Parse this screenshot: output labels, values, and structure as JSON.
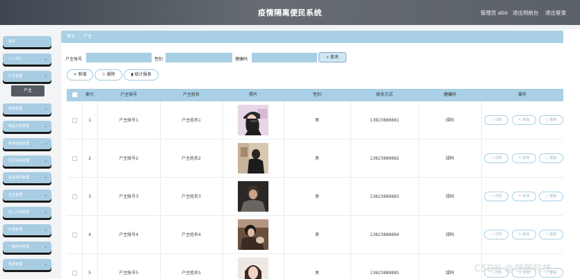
{
  "header": {
    "title": "疫情隔离便民系统",
    "admin": "管理员 abo",
    "back_to_front": "退出到前台",
    "logout": "退出登录"
  },
  "sidebar": {
    "items": [
      {
        "label": "首页"
      },
      {
        "label": "个人中心"
      },
      {
        "label": "户主管理"
      },
      {
        "label": "物资管理"
      },
      {
        "label": "物品分类管理"
      },
      {
        "label": "物资商品管理"
      },
      {
        "label": "社区采购管理"
      },
      {
        "label": "在线询问管理"
      },
      {
        "label": "业主管理"
      },
      {
        "label": "线上问诊管理"
      },
      {
        "label": "片管管理"
      },
      {
        "label": "一键呼叫管理"
      },
      {
        "label": "系统管理"
      }
    ],
    "active_sub": "户主"
  },
  "breadcrumb": {
    "home": "首页",
    "sep": "/",
    "current": "户主"
  },
  "search": {
    "account_label": "户主账号",
    "gender_label": "性别",
    "health_label": "健康码",
    "button": "查询",
    "search_icon": "⌕"
  },
  "ops": {
    "add": "+ 新增",
    "del": "删除",
    "report": "统计报表"
  },
  "table": {
    "columns": [
      "索引",
      "户主账号",
      "户主姓名",
      "照片",
      "性别",
      "联系方式",
      "健康码",
      "操作"
    ],
    "rows": [
      {
        "index": "1",
        "account": "户主账号1",
        "name": "户主姓名1",
        "gender": "男",
        "phone": "13823888881",
        "health": "绿码"
      },
      {
        "index": "2",
        "account": "户主账号2",
        "name": "户主姓名2",
        "gender": "男",
        "phone": "13823888882",
        "health": "绿码"
      },
      {
        "index": "3",
        "account": "户主账号3",
        "name": "户主姓名3",
        "gender": "男",
        "phone": "13823888883",
        "health": "绿码"
      },
      {
        "index": "4",
        "account": "户主账号4",
        "name": "户主姓名4",
        "gender": "男",
        "phone": "13823888884",
        "health": "绿码"
      },
      {
        "index": "5",
        "account": "户主账号5",
        "name": "户主姓名5",
        "gender": "男",
        "phone": "13823888885",
        "health": "绿码"
      }
    ],
    "actions": {
      "detail": "详情",
      "edit": "修改",
      "delete": "删除"
    }
  },
  "watermark": "CSDN @邻居科技",
  "colors": {
    "accent": "#a9d0e6",
    "header": "#4f565e",
    "active": "#555b61"
  }
}
